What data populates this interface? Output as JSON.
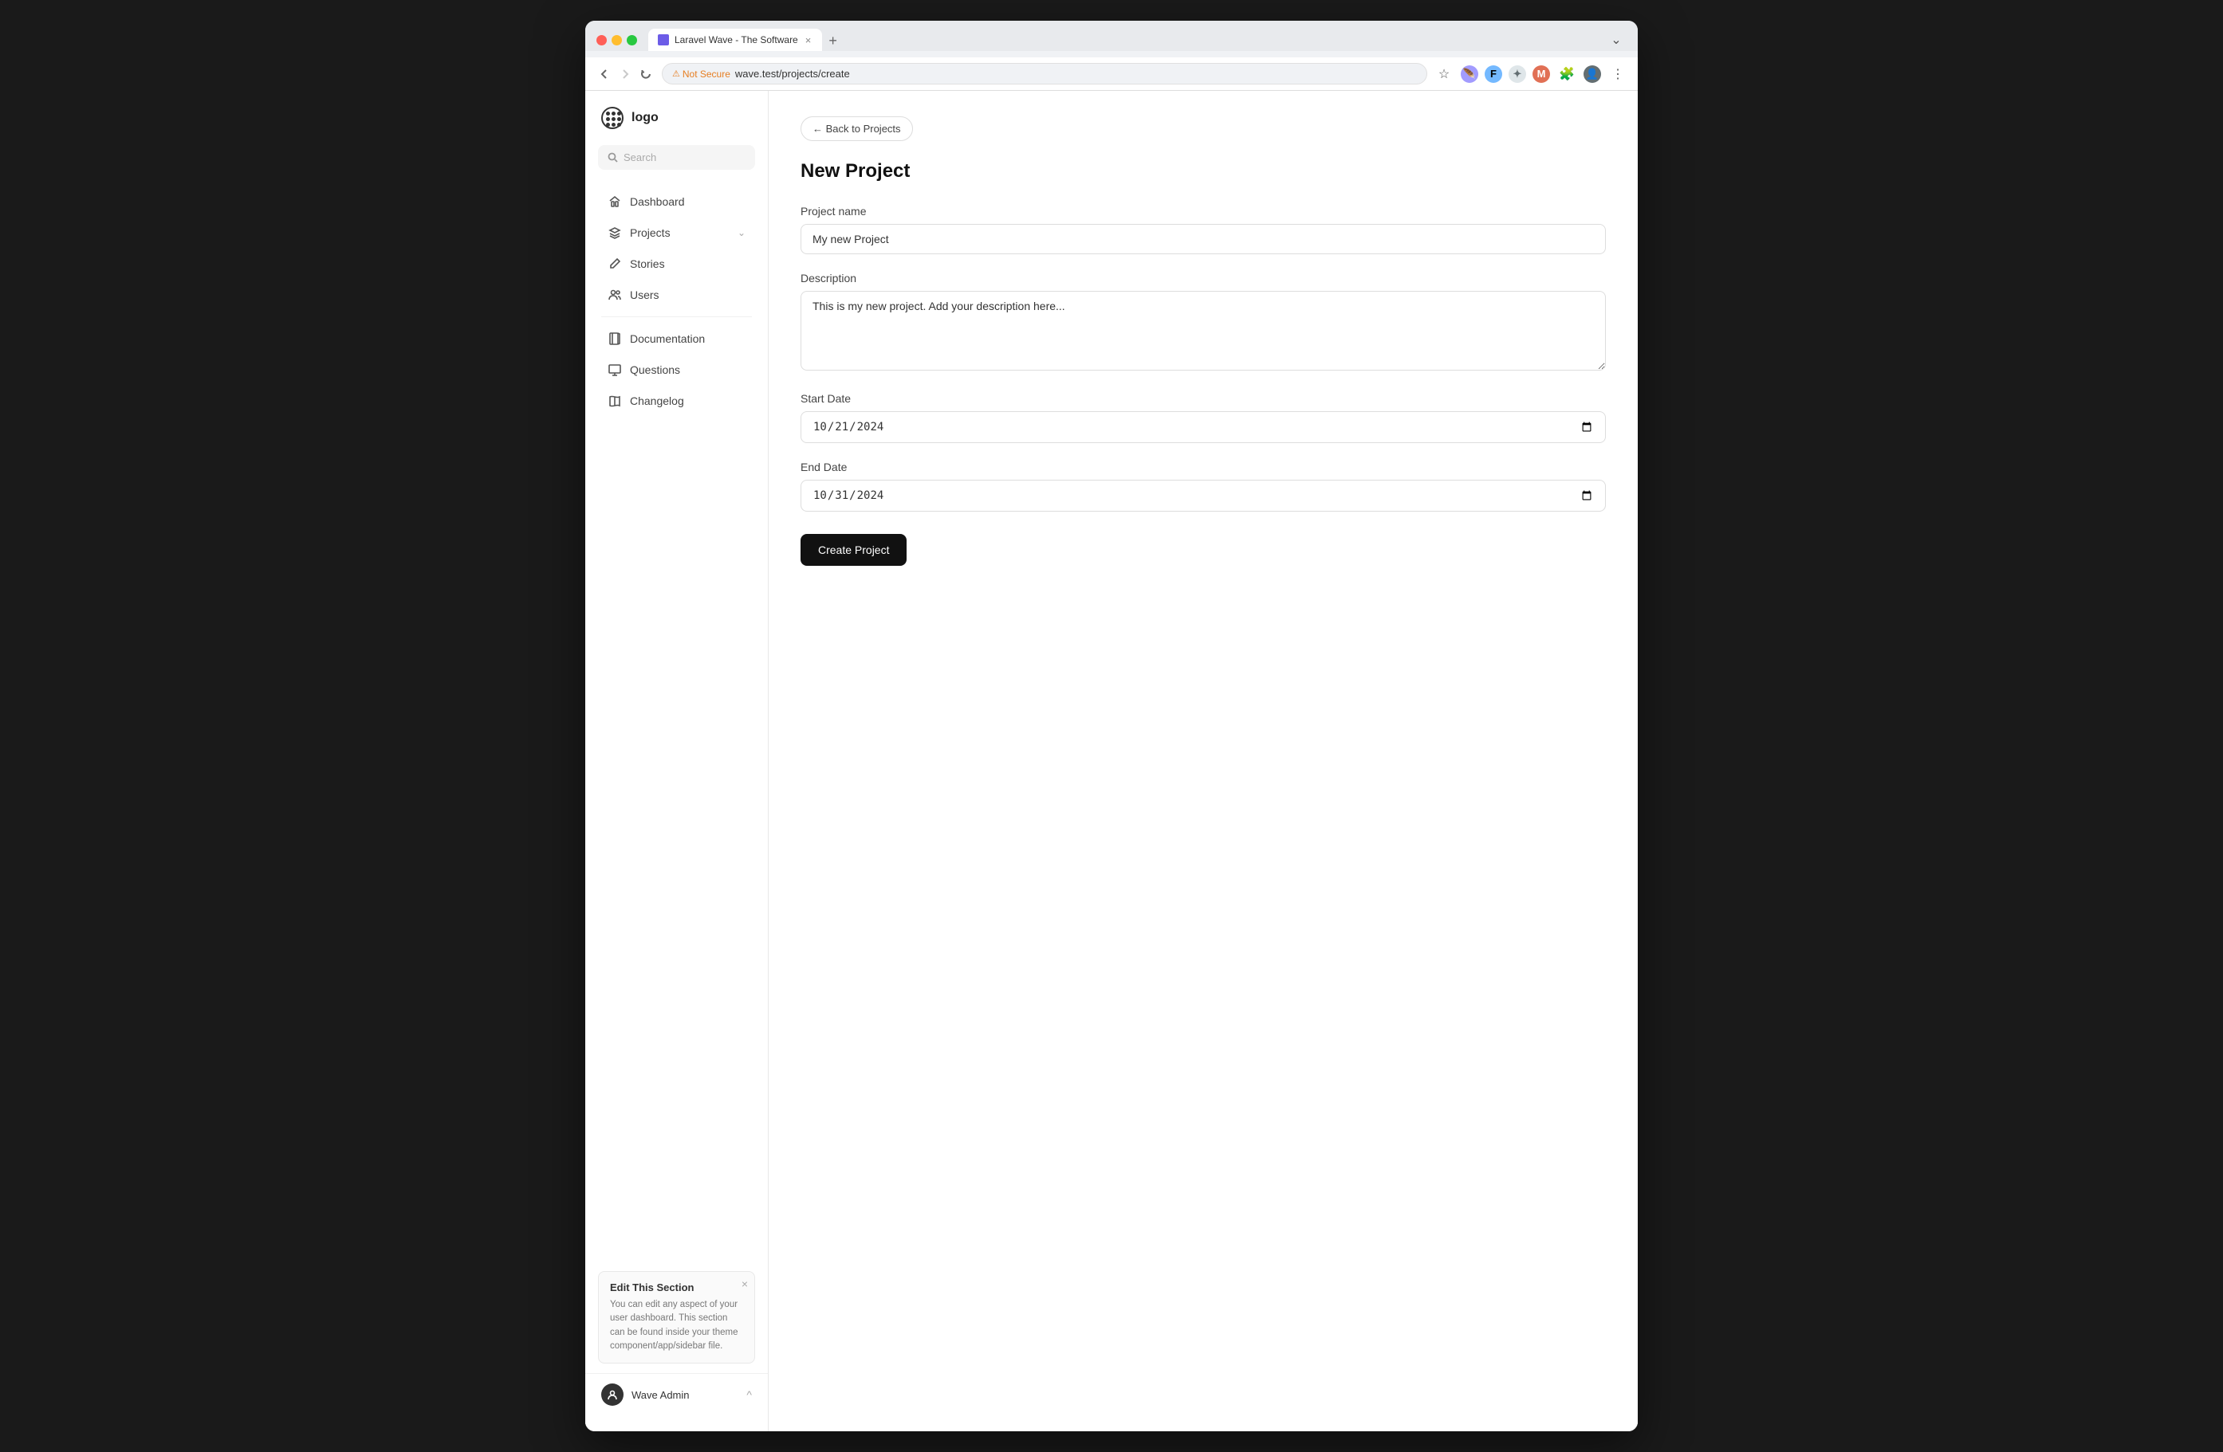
{
  "browser": {
    "tab_title": "Laravel Wave - The Software",
    "url": "wave.test/projects/create",
    "url_security": "Not Secure",
    "new_tab_label": "+",
    "tab_close": "×"
  },
  "sidebar": {
    "logo_text": "logo",
    "search_placeholder": "Search",
    "nav_items": [
      {
        "id": "dashboard",
        "label": "Dashboard",
        "icon": "home"
      },
      {
        "id": "projects",
        "label": "Projects",
        "icon": "layers",
        "has_chevron": true
      },
      {
        "id": "stories",
        "label": "Stories",
        "icon": "pen"
      },
      {
        "id": "users",
        "label": "Users",
        "icon": "users"
      }
    ],
    "bottom_links": [
      {
        "id": "documentation",
        "label": "Documentation",
        "icon": "book"
      },
      {
        "id": "questions",
        "label": "Questions",
        "icon": "monitor"
      },
      {
        "id": "changelog",
        "label": "Changelog",
        "icon": "book-open"
      }
    ],
    "edit_section": {
      "title": "Edit This Section",
      "text": "You can edit any aspect of your user dashboard. This section can be found inside your theme component/app/sidebar file."
    },
    "footer_user": "Wave Admin",
    "footer_chevron": "^"
  },
  "main": {
    "back_button": "← Back to Projects",
    "page_title": "New Project",
    "form": {
      "project_name_label": "Project name",
      "project_name_value": "My new Project",
      "description_label": "Description",
      "description_value": "This is my new project. Add your description here...",
      "start_date_label": "Start Date",
      "start_date_value": "10/21/2024",
      "end_date_label": "End Date",
      "end_date_value": "10/31/2024",
      "submit_label": "Create Project"
    }
  }
}
